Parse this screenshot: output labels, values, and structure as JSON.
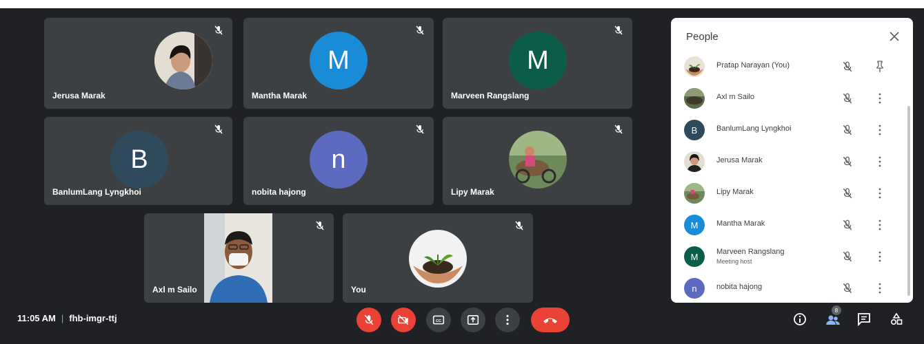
{
  "meeting": {
    "time": "11:05 AM",
    "code": "fhb-imgr-ttj"
  },
  "tiles": [
    {
      "name": "Jerusa Marak"
    },
    {
      "name": "Mantha Marak",
      "initial": "M"
    },
    {
      "name": "Marveen Rangslang",
      "initial": "M"
    },
    {
      "name": "BanlumLang Lyngkhoi",
      "initial": "B"
    },
    {
      "name": "nobita hajong",
      "initial": "n"
    },
    {
      "name": "Lipy Marak"
    },
    {
      "name": "Axl m Sailo"
    },
    {
      "name": "You"
    }
  ],
  "people_panel": {
    "title": "People",
    "participant_count_badge": "8",
    "participants": [
      {
        "name": "Pratap Narayan (You)",
        "action": "pin-icon"
      },
      {
        "name": "Axl m Sailo",
        "action": "more-icon"
      },
      {
        "name": "BanlumLang Lyngkhoi",
        "initial": "B",
        "action": "more-icon"
      },
      {
        "name": "Jerusa Marak",
        "action": "more-icon"
      },
      {
        "name": "Lipy Marak",
        "action": "more-icon"
      },
      {
        "name": "Mantha Marak",
        "initial": "M",
        "action": "more-icon"
      },
      {
        "name": "Marveen Rangslang",
        "initial": "M",
        "subtitle": "Meeting host",
        "action": "more-icon"
      },
      {
        "name": "nobita hajong",
        "initial": "n",
        "action": "more-icon"
      }
    ]
  },
  "colors": {
    "background": "#202124",
    "tile": "#3c4043",
    "red": "#ea4335",
    "mantha": "#1a8bd6",
    "marveen": "#0b5d49",
    "banlum": "#2f4a5c",
    "nobita": "#5c6bc0",
    "badge": "#5f6368"
  }
}
